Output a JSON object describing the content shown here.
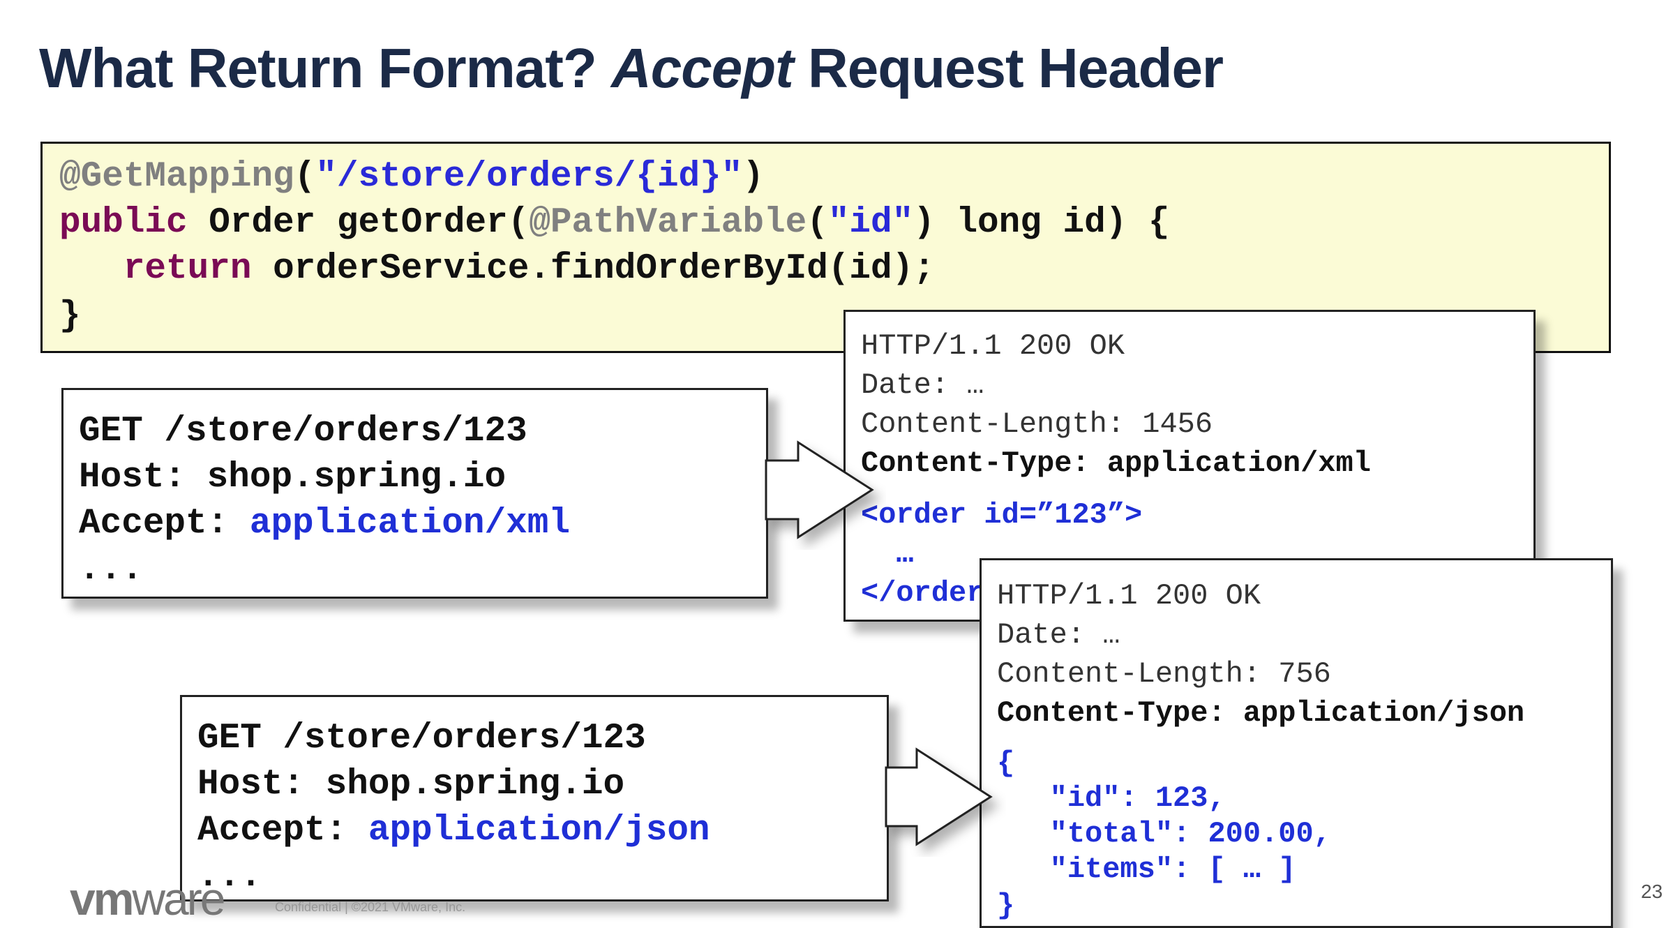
{
  "title": {
    "part1": "What Return Format? ",
    "italic": "Accept",
    "part2": " Request  Header"
  },
  "code": {
    "line1": {
      "annotation": "@GetMapping",
      "open": "(",
      "string": "\"/store/orders/{id}\"",
      "close": ")"
    },
    "line2": {
      "keyword": "public",
      "text1": " Order getOrder(",
      "annotation": "@PathVariable",
      "open": "(",
      "string": "\"id\"",
      "text2": ") long id) {"
    },
    "line3": {
      "indent": "   ",
      "keyword": "return",
      "text": " orderService.findOrderById(id);"
    },
    "line4": {
      "text": "}"
    }
  },
  "request_xml": {
    "line1": "GET /store/orders/123",
    "line2": "Host: shop.spring.io",
    "accept_label": "Accept: ",
    "accept_value": "application/xml",
    "line4": "..."
  },
  "request_json": {
    "line1": "GET /store/orders/123",
    "line2": "Host: shop.spring.io",
    "accept_label": "Accept: ",
    "accept_value": "application/json",
    "line4": "..."
  },
  "response_xml": {
    "status": "HTTP/1.1 200 OK",
    "date": "Date: …",
    "length": "Content-Length: 1456",
    "type": "Content-Type: application/xml",
    "body1": "<order id=”123”>",
    "body2": "  …",
    "body3": "</order>"
  },
  "response_json": {
    "status": "HTTP/1.1 200 OK",
    "date": "Date: …",
    "length": "Content-Length: 756",
    "type": "Content-Type: application/json",
    "body1": "{",
    "body2": "   \"id\": 123,",
    "body3": "   \"total\": 200.00,",
    "body4": "   \"items\": [ … ]",
    "body5": "}"
  },
  "footer": {
    "logo_vm": "vm",
    "logo_ware": "ware",
    "confidential": "Confidential   |   ©2021 VMware, Inc.",
    "slide_number": "23"
  },
  "colors": {
    "title": "#1b2a47",
    "code_background": "#fbfbd6",
    "annotation": "#808080",
    "keyword": "#7a0a55",
    "string": "#2a2ad8",
    "value_blue": "#1f2fd6"
  }
}
